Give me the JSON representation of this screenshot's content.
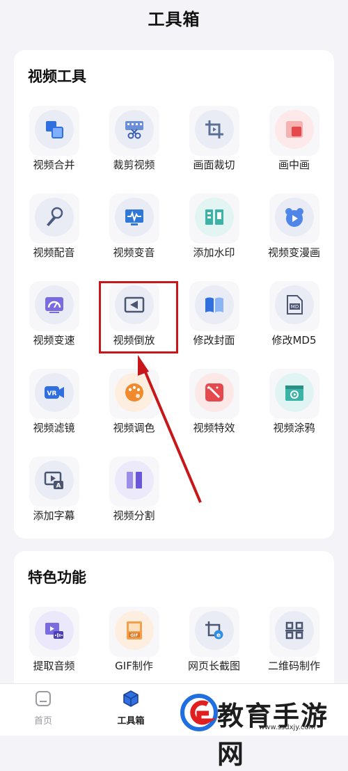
{
  "header": {
    "title": "工具箱"
  },
  "video_tools": {
    "title": "视频工具",
    "items": [
      {
        "label": "视频合并",
        "icon": "merge-icon"
      },
      {
        "label": "裁剪视频",
        "icon": "film-scissors-icon"
      },
      {
        "label": "画面裁切",
        "icon": "crop-icon"
      },
      {
        "label": "画中画",
        "icon": "picture-in-picture-icon"
      },
      {
        "label": "视频配音",
        "icon": "microphone-icon"
      },
      {
        "label": "视频变音",
        "icon": "voice-change-icon"
      },
      {
        "label": "添加水印",
        "icon": "watermark-icon"
      },
      {
        "label": "视频变漫画",
        "icon": "bear-cartoon-icon"
      },
      {
        "label": "视频变速",
        "icon": "speedometer-icon"
      },
      {
        "label": "视频倒放",
        "icon": "reverse-play-icon"
      },
      {
        "label": "修改封面",
        "icon": "book-cover-icon"
      },
      {
        "label": "修改MD5",
        "icon": "md5-file-icon"
      },
      {
        "label": "视频滤镜",
        "icon": "vr-camera-icon"
      },
      {
        "label": "视频调色",
        "icon": "palette-icon"
      },
      {
        "label": "视频特效",
        "icon": "magic-wand-icon"
      },
      {
        "label": "视频涂鸦",
        "icon": "doodle-icon"
      },
      {
        "label": "添加字幕",
        "icon": "subtitle-icon"
      },
      {
        "label": "视频分割",
        "icon": "split-icon"
      }
    ]
  },
  "feature_tools": {
    "title": "特色功能",
    "items": [
      {
        "label": "提取音频",
        "icon": "extract-audio-icon"
      },
      {
        "label": "GIF制作",
        "icon": "gif-icon"
      },
      {
        "label": "网页长截图",
        "icon": "web-screenshot-icon"
      },
      {
        "label": "二维码制作",
        "icon": "qrcode-icon"
      }
    ]
  },
  "tabbar": {
    "items": [
      {
        "label": "首页",
        "icon": "home-icon",
        "active": false
      },
      {
        "label": "工具箱",
        "icon": "toolbox-icon",
        "active": true
      }
    ]
  },
  "watermark": {
    "text": "教育手游网",
    "url": "www.ssdxjy.com"
  },
  "colors": {
    "highlight": "#c8171a",
    "accent_blue": "#2f6fe0",
    "background": "#f3f3f8"
  }
}
